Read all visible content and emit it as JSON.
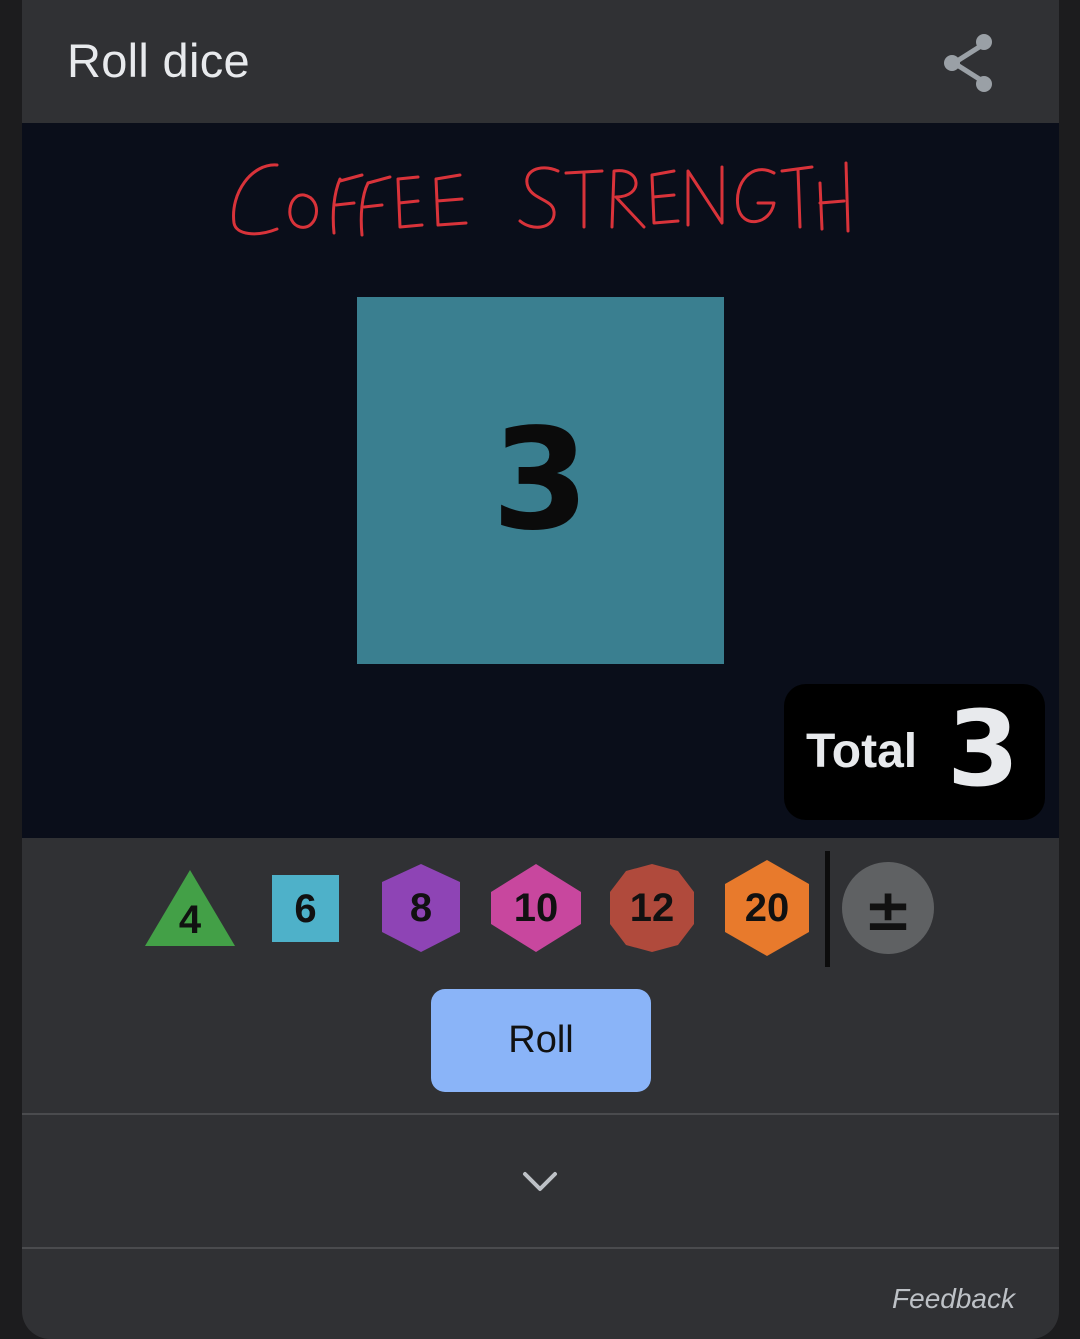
{
  "app": {
    "title": "Roll dice"
  },
  "header": {
    "share_icon": "share-icon"
  },
  "stage": {
    "handwritten_note": "COFFEE STRENGTH",
    "die": {
      "sides": 6,
      "value": "3",
      "color": "#3a7f90"
    },
    "total": {
      "label": "Total",
      "value": "3"
    }
  },
  "dice_options": [
    {
      "label": "4",
      "shape": "triangle-icon",
      "color": "#43a047"
    },
    {
      "label": "6",
      "shape": "square-icon",
      "color": "#4eb1c9"
    },
    {
      "label": "8",
      "shape": "hexagon-icon",
      "color": "#8e44b5"
    },
    {
      "label": "10",
      "shape": "diamond-hexagon-icon",
      "color": "#c8479e"
    },
    {
      "label": "12",
      "shape": "decagon-icon",
      "color": "#b04a3c"
    },
    {
      "label": "20",
      "shape": "hexagon-icon",
      "color": "#e87a2c"
    }
  ],
  "modifier": {
    "label": "±"
  },
  "actions": {
    "roll_label": "Roll",
    "expand_icon": "chevron-down-icon"
  },
  "footer": {
    "feedback_label": "Feedback"
  }
}
